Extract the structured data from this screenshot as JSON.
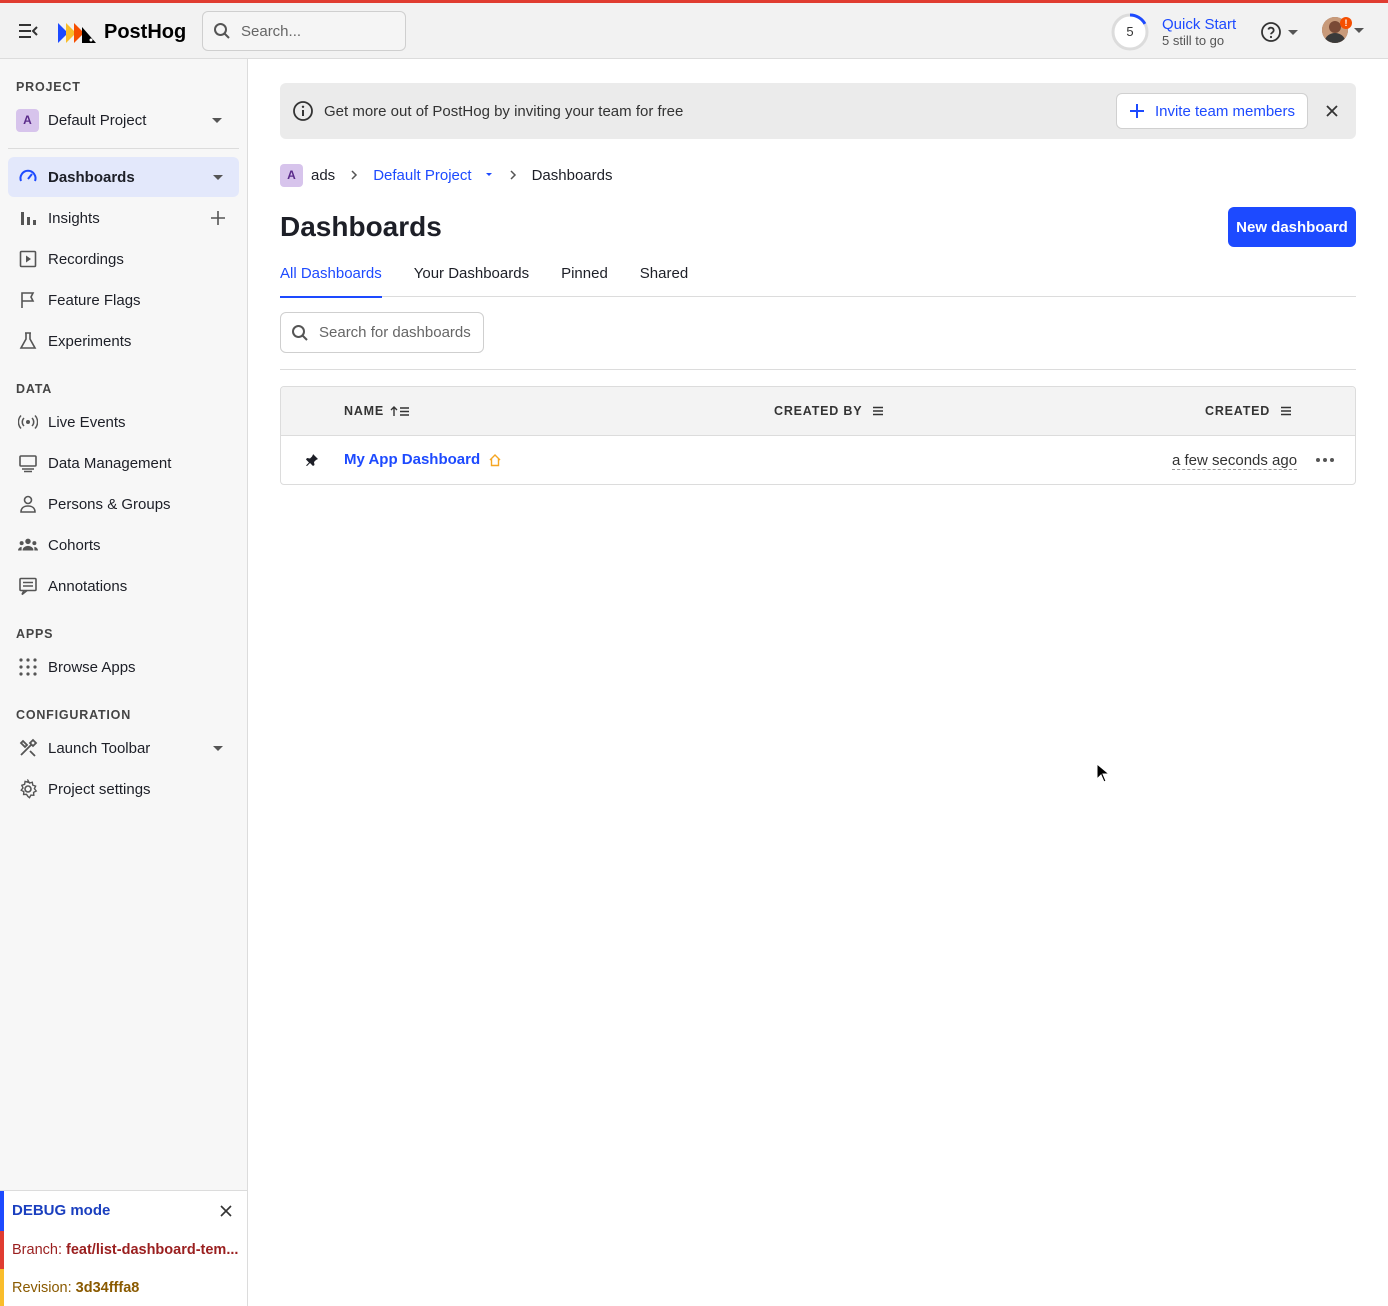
{
  "header": {
    "logo_text": "PostHog",
    "search_placeholder": "Search...",
    "quick_start": {
      "count": "5",
      "title": "Quick Start",
      "subtitle": "5 still to go",
      "progress": 0.17
    },
    "avatar_badge": "!"
  },
  "sidebar": {
    "project_label": "PROJECT",
    "project_badge": "A",
    "project_name": "Default Project",
    "items_main": [
      {
        "label": "Dashboards",
        "icon": "gauge-icon",
        "active": true
      },
      {
        "label": "Insights",
        "icon": "bar-chart-icon"
      },
      {
        "label": "Recordings",
        "icon": "play-square-icon"
      },
      {
        "label": "Feature Flags",
        "icon": "flag-icon"
      },
      {
        "label": "Experiments",
        "icon": "flask-icon"
      }
    ],
    "data_label": "DATA",
    "items_data": [
      {
        "label": "Live Events",
        "icon": "broadcast-icon"
      },
      {
        "label": "Data Management",
        "icon": "database-icon"
      },
      {
        "label": "Persons & Groups",
        "icon": "person-icon"
      },
      {
        "label": "Cohorts",
        "icon": "cohorts-icon"
      },
      {
        "label": "Annotations",
        "icon": "annotation-icon"
      }
    ],
    "apps_label": "APPS",
    "items_apps": [
      {
        "label": "Browse Apps",
        "icon": "apps-grid-icon"
      }
    ],
    "config_label": "CONFIGURATION",
    "items_config": [
      {
        "label": "Launch Toolbar",
        "icon": "tools-icon"
      },
      {
        "label": "Project settings",
        "icon": "gear-icon"
      }
    ]
  },
  "debug": {
    "title": "DEBUG mode",
    "branch_label": "Branch: ",
    "branch_value": "feat/list-dashboard-tem...",
    "revision_label": "Revision: ",
    "revision_value": "3d34fffa8"
  },
  "banner": {
    "text": "Get more out of PostHog by inviting your team for free",
    "invite_label": "Invite team members"
  },
  "breadcrumbs": {
    "org_badge": "A",
    "org": "ads",
    "project": "Default Project",
    "current": "Dashboards"
  },
  "page": {
    "title": "Dashboards",
    "new_button": "New dashboard",
    "tabs": [
      "All Dashboards",
      "Your Dashboards",
      "Pinned",
      "Shared"
    ],
    "active_tab": 0,
    "search_placeholder": "Search for dashboards"
  },
  "table": {
    "columns": [
      "NAME",
      "CREATED BY",
      "CREATED"
    ],
    "rows": [
      {
        "name": "My App Dashboard",
        "created_by": "",
        "created": "a few seconds ago",
        "pinned": true
      }
    ]
  },
  "colors": {
    "accent": "#1d4aff",
    "top_border": "#e03c31",
    "home_icon": "#f5a623"
  }
}
